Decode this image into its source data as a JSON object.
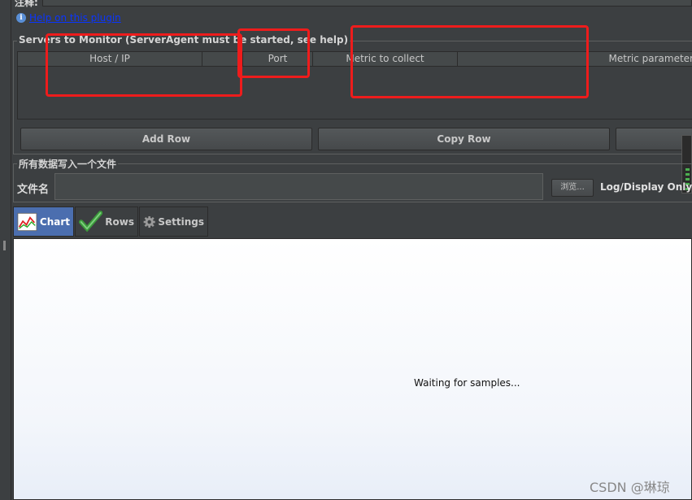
{
  "top": {
    "label": "注释:"
  },
  "help": {
    "icon": "info-icon",
    "link_text": "Help on this plugin"
  },
  "servers": {
    "legend": "Servers to Monitor (ServerAgent must be started, see help)",
    "columns": [
      "Host / IP",
      "Port",
      "Metric to collect",
      "Metric parameter"
    ],
    "buttons": {
      "add": "Add Row",
      "copy": "Copy Row"
    }
  },
  "file": {
    "legend": "所有数据写入一个文件",
    "filename_label": "文件名",
    "filename_value": "",
    "browse_label": "浏览...",
    "log_label": "Log/Display Only:"
  },
  "tabs": [
    {
      "label": "Chart",
      "icon": "chart-icon",
      "active": true
    },
    {
      "label": "Rows",
      "icon": "checkmark-icon",
      "active": false
    },
    {
      "label": "Settings",
      "icon": "gear-icon",
      "active": false
    }
  ],
  "chart": {
    "status": "Waiting for samples..."
  },
  "watermark": "CSDN @琳琼",
  "colors": {
    "annotation": "#ee1c1c",
    "active_tab": "#4b6eaf",
    "link": "#0a35ff"
  }
}
